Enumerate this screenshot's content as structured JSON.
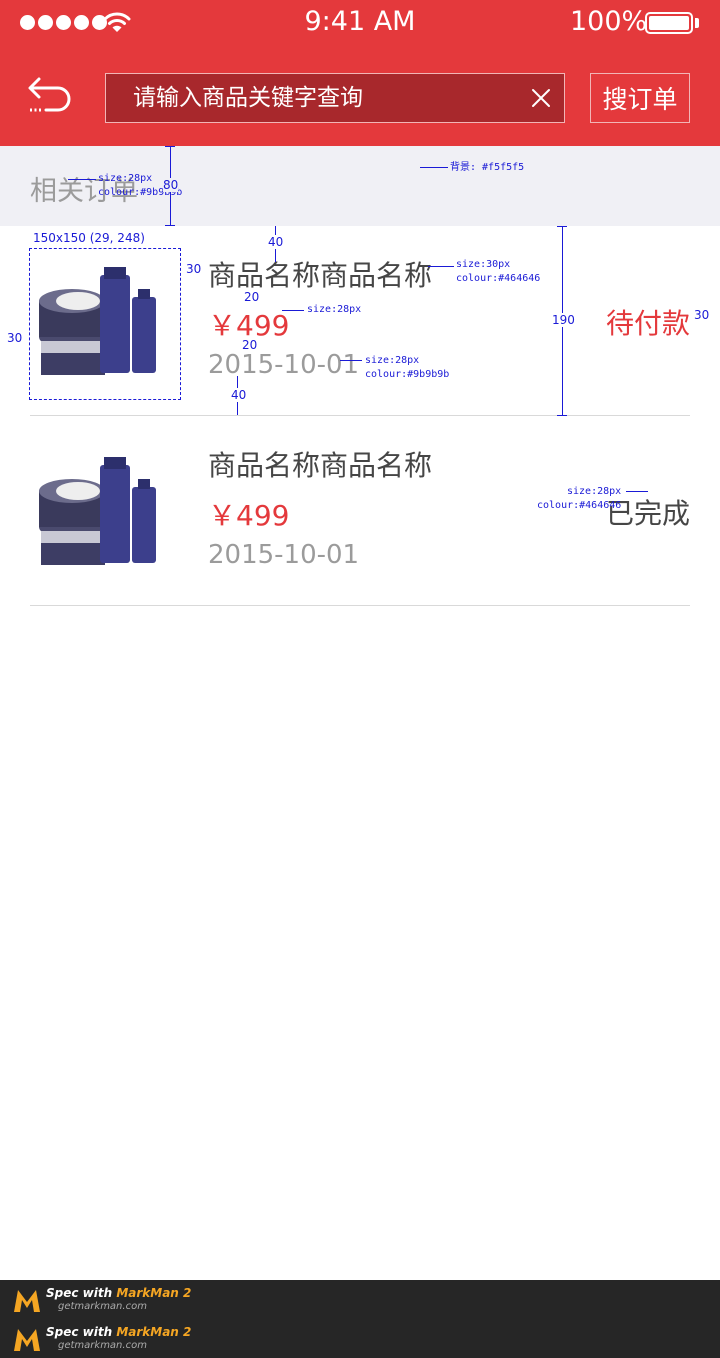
{
  "status_bar": {
    "time": "9:41 AM",
    "battery": "100%"
  },
  "search": {
    "placeholder": "请输入商品关键字查询",
    "button_label": "搜订单"
  },
  "section": {
    "title": "相关订单"
  },
  "orders": [
    {
      "name": "商品名称商品名称",
      "price": "￥499",
      "date": "2015-10-01",
      "status": "待付款"
    },
    {
      "name": "商品名称商品名称",
      "price": "￥499",
      "date": "2015-10-01",
      "status": "已完成"
    }
  ],
  "colors": {
    "brand_red": "#e4393c",
    "section_bg": "#f0f0f5",
    "title_text": "#464646",
    "muted_text": "#9b9b9b"
  },
  "annotations": {
    "section_font": "size:28px",
    "section_colour": "colour:#9b9b9b",
    "section_height": "80",
    "bg_note": "背景: #f5f5f5",
    "image_size": "150x150 (29, 248)",
    "pad_right": "30",
    "pad_left": "30",
    "gap_top": "40",
    "gap_bottom": "40",
    "gap_a": "20",
    "gap_b": "20",
    "row_height": "190",
    "status_right": "30",
    "name_font": "size:30px",
    "name_colour": "colour:#464646",
    "price_font": "size:28px",
    "date_font": "size:28px",
    "date_colour": "colour:#9b9b9b",
    "status_font": "size:28px",
    "status_colour": "colour:#464646"
  },
  "markman": {
    "label_prefix": "Spec with ",
    "label_brand": "MarkMan 2",
    "site": "getmarkman.com"
  }
}
